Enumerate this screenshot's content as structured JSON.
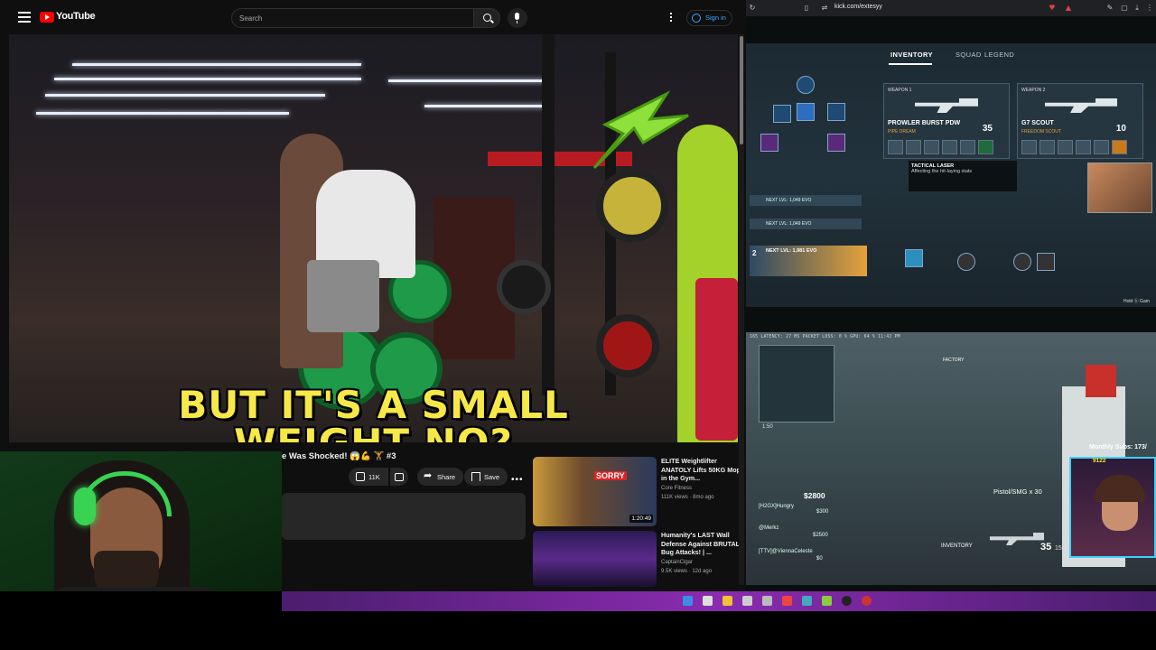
{
  "youtube": {
    "brand": "YouTube",
    "search_placeholder": "Search",
    "signin_label": "Sign in",
    "video": {
      "overlay_line1": "BUT IT'S A SMALL",
      "overlay_line2": "WEIGHT NO?",
      "title": "e Was Shocked! 😱💪 🏋 #3",
      "likes": "11K",
      "share_label": "Share",
      "save_label": "Save"
    },
    "recommendations": [
      {
        "title": "ELITE Weightlifter ANATOLY Lifts 50KG Mop in the Gym... ",
        "channel": "Core Fitness",
        "meta": "111K views · 8mo ago",
        "duration": "1:20:49",
        "thumb_caption": "SORRY"
      },
      {
        "title": "Humanity's LAST Wall Defense Against BRUTAL Bug Attacks! | ...",
        "channel": "CaptainCigar",
        "meta": "9.5K views · 12d ago",
        "duration": "",
        "thumb_caption": ""
      }
    ]
  },
  "kick": {
    "url": "kick.com/extesyy",
    "game1": {
      "tabs": [
        "INVENTORY",
        "SQUAD",
        "LEGEND"
      ],
      "active_tab": "INVENTORY",
      "weapons": [
        {
          "slot": "WEAPON 1",
          "name": "PROWLER BURST PDW",
          "sub": "PIPE DREAM",
          "ammo": "35"
        },
        {
          "slot": "WEAPON 2",
          "name": "G7 SCOUT",
          "sub": "FREEDOM SCOUT",
          "ammo": "10"
        }
      ],
      "tooltip_title": "TACTICAL LASER",
      "tooltip_body": "Affecting the hit-laying stats",
      "squad_rows": [
        "NEXT LVL: 1,049 EVO",
        "NEXT LVL: 1,049 EVO"
      ],
      "squad_main_label": "NEXT LVL: 1,981 EVO",
      "squad_rank": "2",
      "hold_label": "Hold ⓑ Gam"
    },
    "game2": {
      "stats": "165 LATENCY: 27 MS PACKET LOSS: 0 % GPU: 64 % 11:42 PM",
      "map_time": "1:50",
      "location": "FACTORY",
      "money_total": "$2800",
      "money_rows": [
        {
          "name": "[H2GX]Hungry",
          "amount": "$300"
        },
        {
          "name": "@Merkz",
          "amount": "$2500"
        },
        {
          "name": "[TTV]@ViennaCeleste",
          "amount": "$0"
        }
      ],
      "weapon_label": "Pistol/SMG x 30",
      "inventory_label": "INVENTORY",
      "ammo": "35",
      "ammo_reserve": "150",
      "subs_label": "Monthly Subs: 173/",
      "subs_count": "9122"
    }
  },
  "colors": {
    "youtube_red": "#ff0000",
    "overlay_yellow": "#f7e84a",
    "taskbar_purple": "#8a2bb0",
    "headset_green": "#39d353"
  }
}
